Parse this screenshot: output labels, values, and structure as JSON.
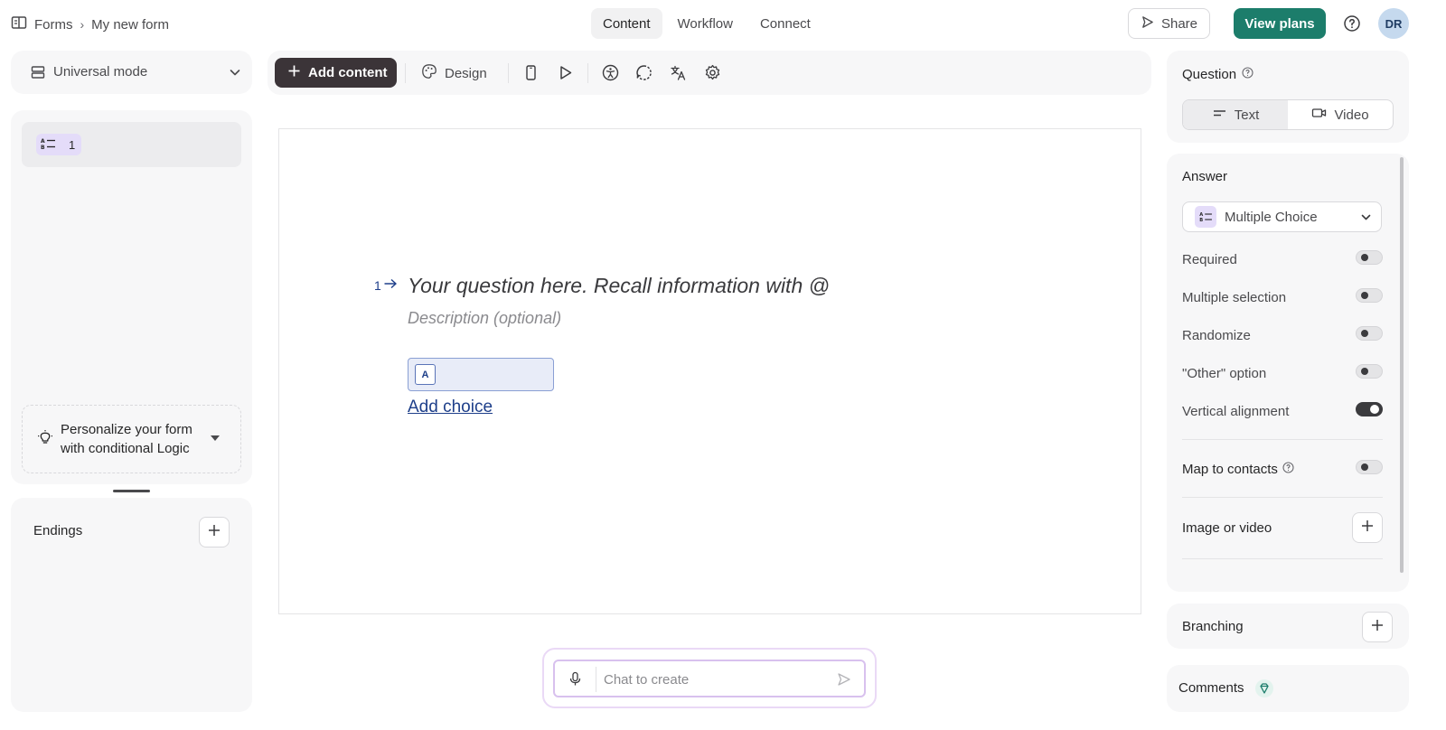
{
  "header": {
    "breadcrumb_root": "Forms",
    "breadcrumb_current": "My new form",
    "tabs": [
      "Content",
      "Workflow",
      "Connect"
    ],
    "active_tab": "Content",
    "share_label": "Share",
    "view_plans_label": "View plans",
    "avatar_initials": "DR",
    "accent_color": "#1c7d6b"
  },
  "sidebar": {
    "mode_label": "Universal mode",
    "question_number": "1",
    "logic_prompt": "Personalize your form with conditional Logic",
    "endings_label": "Endings"
  },
  "toolbar": {
    "add_content_label": "Add content",
    "design_label": "Design",
    "icons": [
      "mobile-preview-icon",
      "play-icon",
      "accessibility-icon",
      "loading-icon",
      "translate-icon",
      "settings-icon"
    ]
  },
  "canvas": {
    "question_number": "1",
    "question_placeholder": "Your question here. Recall information with @",
    "description_placeholder": "Description (optional)",
    "choice_key": "A",
    "add_choice_label": "Add choice"
  },
  "chat": {
    "placeholder": "Chat to create"
  },
  "right_panel": {
    "question_title": "Question",
    "question_types": [
      "Text",
      "Video"
    ],
    "active_question_type": "Text",
    "answer_title": "Answer",
    "answer_type": "Multiple Choice",
    "options": [
      {
        "label": "Required",
        "on": false
      },
      {
        "label": "Multiple selection",
        "on": false
      },
      {
        "label": "Randomize",
        "on": false
      },
      {
        "label": "\"Other\" option",
        "on": false
      },
      {
        "label": "Vertical alignment",
        "on": true
      }
    ],
    "map_to_contacts_label": "Map to contacts",
    "map_to_contacts_on": false,
    "image_video_label": "Image or video",
    "branching_label": "Branching",
    "comments_label": "Comments"
  }
}
